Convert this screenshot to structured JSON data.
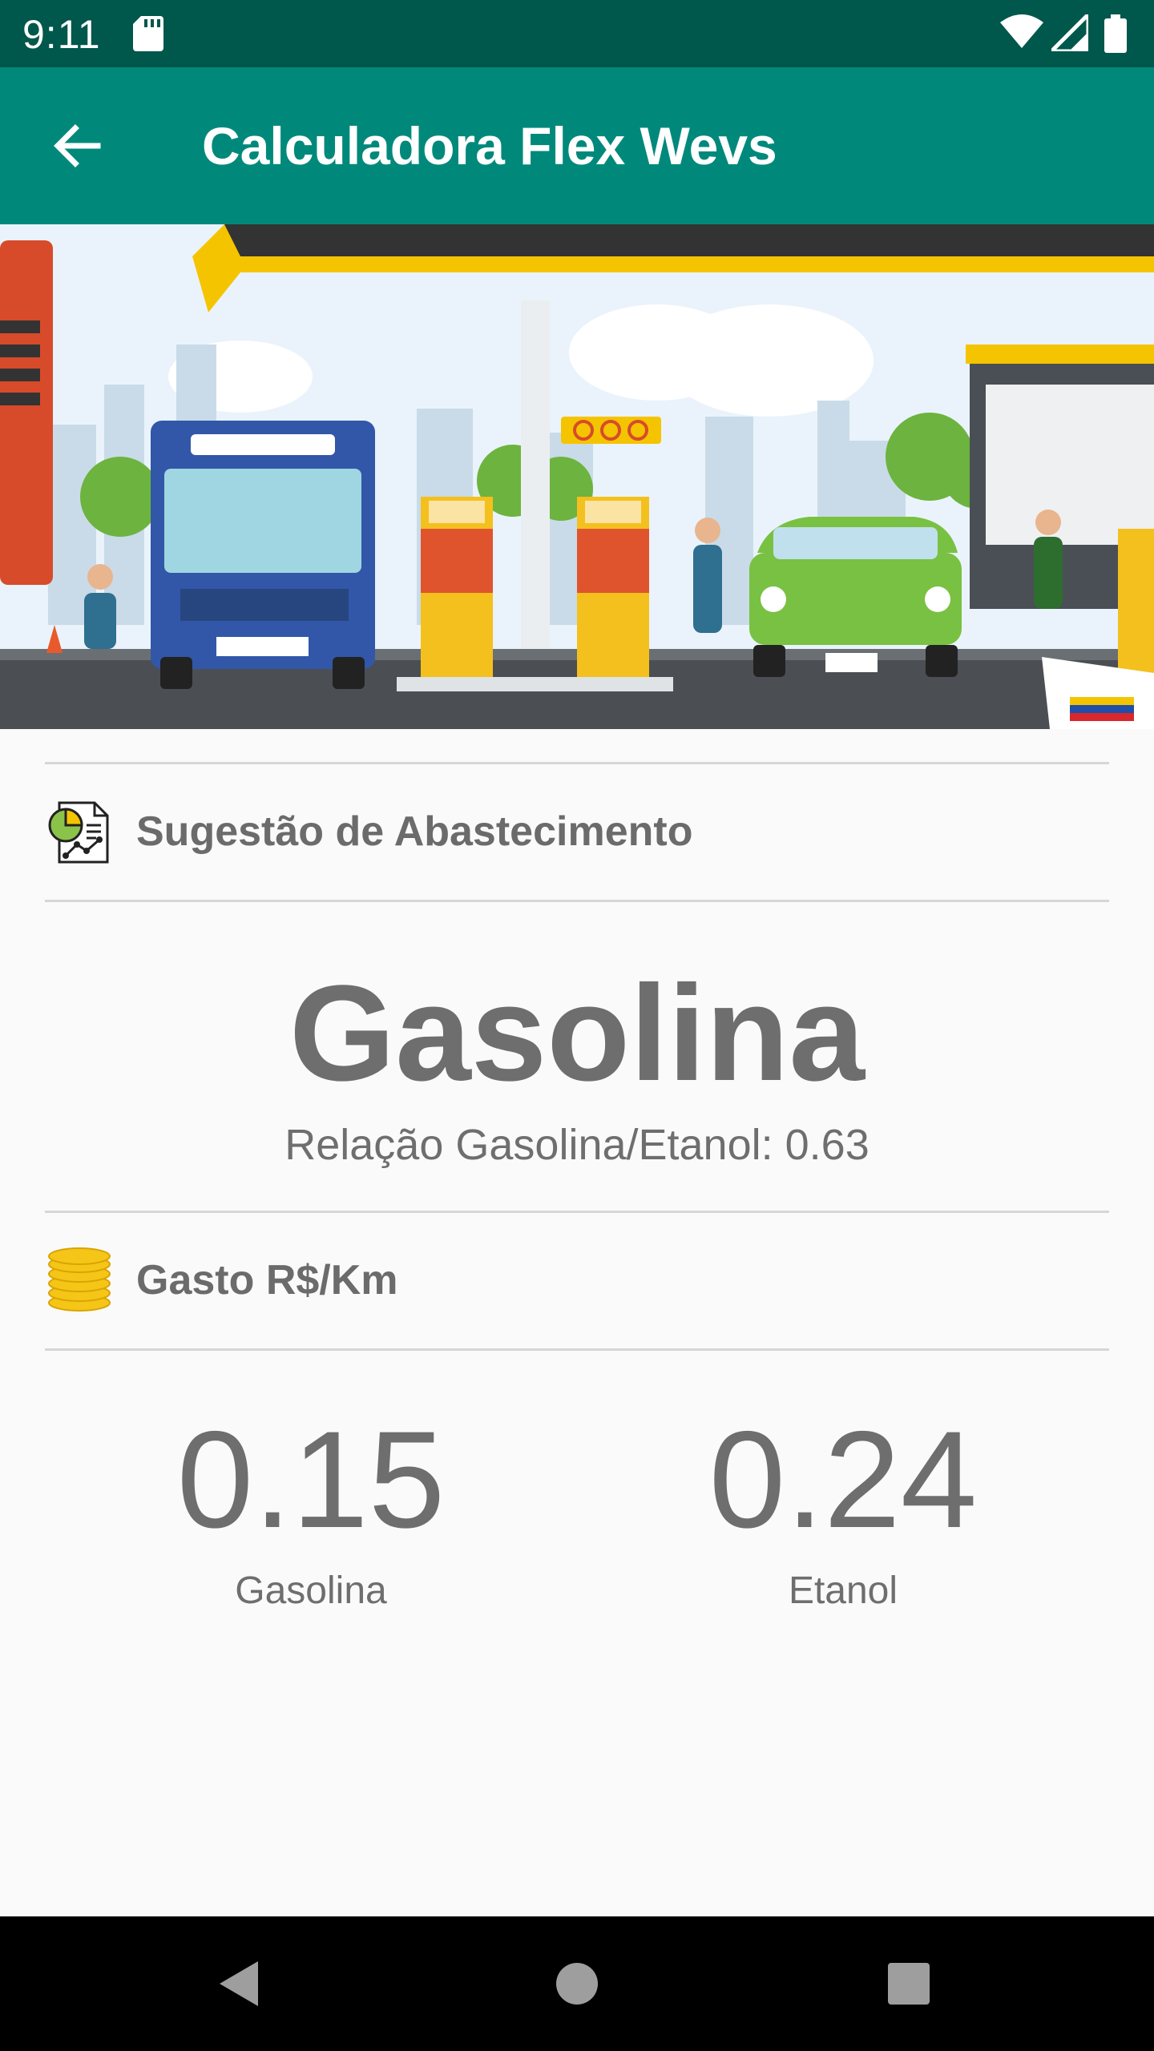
{
  "status_bar": {
    "time": "9:11",
    "icons": [
      "sd-card-icon",
      "wifi-icon",
      "cell-signal-icon",
      "battery-icon"
    ]
  },
  "toolbar": {
    "back_icon": "arrow-back-icon",
    "title": "Calculadora Flex Wevs"
  },
  "banner": {
    "description_icon": "gas-station-illustration"
  },
  "suggestion": {
    "icon": "report-chart-icon",
    "title": "Sugestão de Abastecimento",
    "result": "Gasolina",
    "ratio": "Relação Gasolina/Etanol: 0.63"
  },
  "cost": {
    "icon": "coins-icon",
    "title": "Gasto R$/Km",
    "gasolina_value": "0.15",
    "gasolina_label": "Gasolina",
    "etanol_value": "0.24",
    "etanol_label": "Etanol"
  },
  "nav": {
    "icons": [
      "back-triangle-icon",
      "home-circle-icon",
      "recents-square-icon"
    ]
  },
  "colors": {
    "status_bar": "#00574b",
    "toolbar": "#00897b",
    "text_gray": "#6e6e6e",
    "coin_yellow": "#f5c518"
  }
}
